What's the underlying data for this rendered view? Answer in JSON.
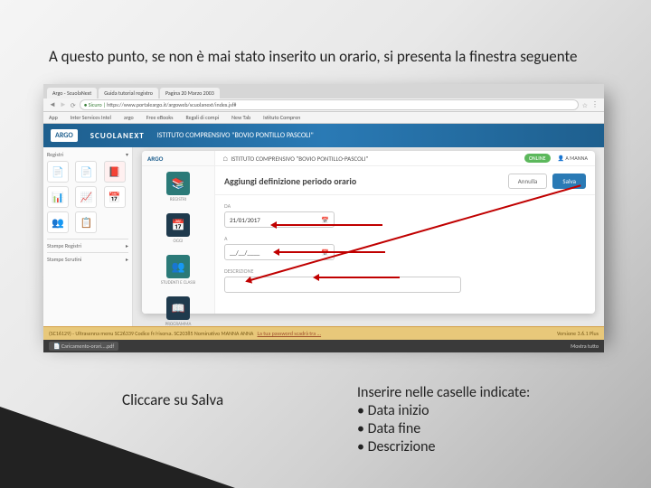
{
  "slide": {
    "top_text": "A questo punto, se non è mai stato inserito un orario, si presenta la finestra seguente",
    "caption_left": "Cliccare su Salva",
    "caption_right_heading": "Inserire nelle caselle indicate:",
    "caption_right_items": [
      "Data inizio",
      "Data fine",
      "Descrizione"
    ]
  },
  "browser": {
    "tabs": [
      "Argo - ScuolaNext",
      "Guida tutorial registro",
      "Pagina 20 Marzo 2003"
    ],
    "secure_label": "Sicuro",
    "url": "https://www.portaleargo.it/argoweb/scuolanext/index.jsf#",
    "bookmarks": [
      "App",
      "Inter Services Intel",
      "argo",
      "Free eBooks",
      "Regali di compi",
      "New Tab",
      "Istituto Compren"
    ]
  },
  "app": {
    "brand": "ARGO",
    "product": "SCUOLANEXT",
    "school": "ISTITUTO COMPRENSIVO \"BOVIO PONTILLO PASCOLI\"",
    "sidebar_label": "Registri",
    "sidebar_sections": [
      "Stampe Registri",
      "Stampe Scrutini"
    ]
  },
  "modal": {
    "brand": "ARGO",
    "title_school": "ISTITUTO COMPRENSIVO \"BOVIO PONTILLO-PASCOLI\"",
    "online": "ONLINE",
    "user": "A MANNA",
    "menu": {
      "registri": "REGISTRI",
      "oggi": "OGGI",
      "studenti": "STUDENTI E CLASSI",
      "programma": "PROGRAMMA"
    },
    "form": {
      "title": "Aggiungi definizione periodo orario",
      "btn_cancel": "Annulla",
      "btn_save": "Salva",
      "da_label": "DA",
      "da_value": "21/01/2017",
      "a_label": "A",
      "a_value": "__/__/____",
      "desc_label": "DESCRIZIONE",
      "desc_value": ""
    }
  },
  "status": {
    "left": "(SC16129) - Ultrasenna menu SC26339 Codice fr/risorsa. SC20385 Nominativo MANNA ANNA",
    "link": "La tua password scadrà tra ...",
    "version": "Versione 3.6.1 Plus"
  },
  "footer": {
    "download": "Caricamento-orari....pdf",
    "show_all": "Mostra tutto"
  }
}
